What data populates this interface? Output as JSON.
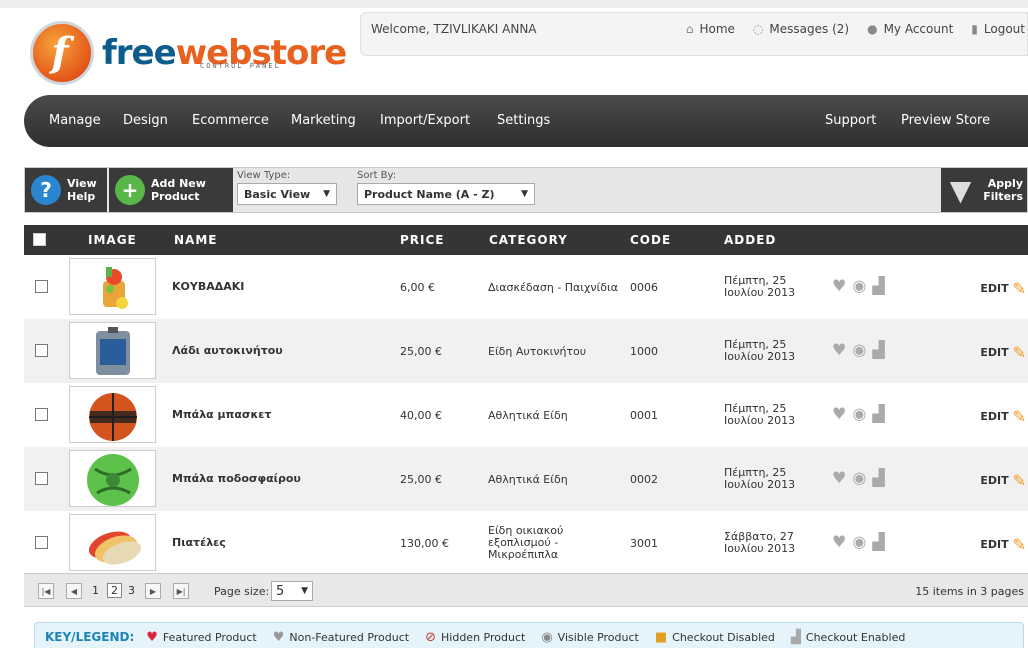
{
  "header": {
    "logo_letter": "f",
    "logo_part1": "free",
    "logo_part2": "webstore",
    "logo_sub": "CONTROL PANEL",
    "welcome": "Welcome, TZIVLIKAKI ANNA",
    "links": {
      "home": "Home",
      "messages": "Messages (2)",
      "account": "My Account",
      "logout": "Logout"
    }
  },
  "nav": {
    "manage": "Manage",
    "design": "Design",
    "ecommerce": "Ecommerce",
    "marketing": "Marketing",
    "import_export": "Import/Export",
    "settings": "Settings",
    "support": "Support",
    "preview": "Preview Store"
  },
  "toolbar": {
    "help_line1": "View",
    "help_line2": "Help",
    "add_line1": "Add New",
    "add_line2": "Product",
    "view_type_label": "View Type:",
    "view_type_value": "Basic View",
    "sort_label": "Sort By:",
    "sort_value": "Product Name (A - Z)",
    "apply_line1": "Apply",
    "apply_line2": "Filters"
  },
  "table": {
    "headers": {
      "image": "IMAGE",
      "name": "NAME",
      "price": "PRICE",
      "category": "CATEGORY",
      "code": "CODE",
      "added": "ADDED"
    },
    "edit_label": "EDIT",
    "rows": [
      {
        "name": "ΚΟΥΒΑΔΑΚΙ",
        "price": "6,00 €",
        "category": "Διασκέδαση - Παιχνίδια",
        "code": "0006",
        "added_l1": "Πέμπτη, 25",
        "added_l2": "Ιουλίου 2013"
      },
      {
        "name": "Λάδι αυτοκινήτου",
        "price": "25,00 €",
        "category": "Είδη Αυτοκινήτου",
        "code": "1000",
        "added_l1": "Πέμπτη, 25",
        "added_l2": "Ιουλίου 2013"
      },
      {
        "name": "Μπάλα μπασκετ",
        "price": "40,00 €",
        "category": "Αθλητικά Είδη",
        "code": "0001",
        "added_l1": "Πέμπτη, 25",
        "added_l2": "Ιουλίου 2013"
      },
      {
        "name": "Μπάλα ποδοσφαίρου",
        "price": "25,00 €",
        "category": "Αθλητικά Είδη",
        "code": "0002",
        "added_l1": "Πέμπτη, 25",
        "added_l2": "Ιουλίου 2013"
      },
      {
        "name": "Πιατέλες",
        "price": "130,00 €",
        "category": "Είδη οικιακού εξοπλισμού - Μικροέπιπλα",
        "code": "3001",
        "added_l1": "Σάββατο, 27",
        "added_l2": "Ιουλίου 2013"
      }
    ]
  },
  "pager": {
    "pages": [
      "1",
      "2",
      "3"
    ],
    "current_page": "2",
    "page_size_label": "Page size:",
    "page_size": "5",
    "info": "15 items in 3 pages"
  },
  "legend": {
    "key": "KEY/LEGEND:",
    "featured": "Featured Product",
    "non_featured": "Non-Featured Product",
    "hidden": "Hidden Product",
    "visible": "Visible Product",
    "checkout_disabled": "Checkout Disabled",
    "checkout_enabled": "Checkout Enabled"
  },
  "colors": {
    "brand_blue": "#0c5c8c",
    "brand_orange": "#e8611e",
    "nav_bg": "#353535",
    "legend_key": "#1c84b6"
  }
}
